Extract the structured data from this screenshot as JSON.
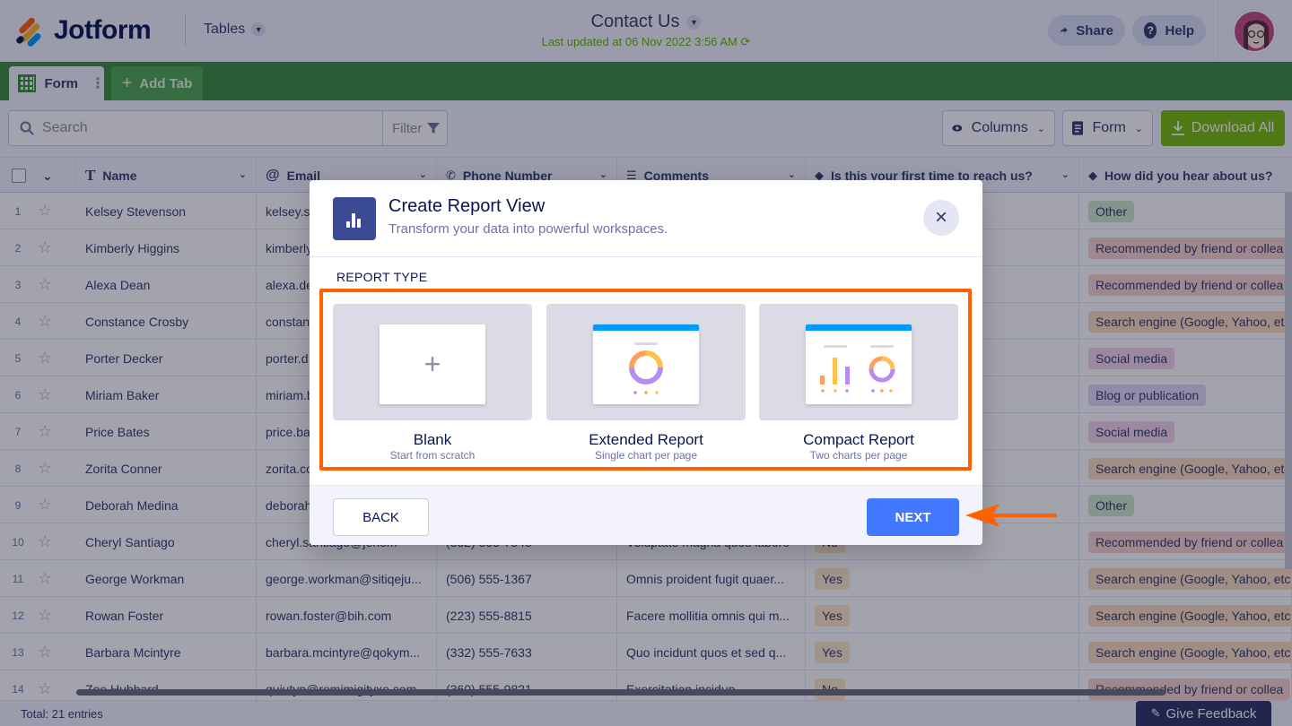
{
  "app": {
    "logo_text": "Jotform",
    "tables_label": "Tables"
  },
  "header": {
    "title": "Contact Us",
    "last_updated": "Last updated at 06 Nov 2022 3:56 AM",
    "share_label": "Share",
    "help_label": "Help"
  },
  "tabs": {
    "form_tab": "Form",
    "add_tab": "Add Tab"
  },
  "toolbar": {
    "search_placeholder": "Search",
    "filter_label": "Filter",
    "columns_label": "Columns",
    "form_label": "Form",
    "download_label": "Download All"
  },
  "table": {
    "columns": [
      "Name",
      "Email",
      "Phone Number",
      "Comments",
      "Is this your first time to reach us?",
      "How did you hear about us?"
    ],
    "rows": [
      {
        "num": "1",
        "name": "Kelsey Stevenson",
        "email": "kelsey.s",
        "phone": "",
        "comment": "",
        "first": "",
        "source": "Other",
        "src_color": "#cfe8cf"
      },
      {
        "num": "2",
        "name": "Kimberly Higgins",
        "email": "kimberly",
        "phone": "",
        "comment": "",
        "first": "",
        "source": "Recommended by friend or collea",
        "src_color": "#f8d3cd"
      },
      {
        "num": "3",
        "name": "Alexa Dean",
        "email": "alexa.de",
        "phone": "",
        "comment": "",
        "first": "",
        "source": "Recommended by friend or collea",
        "src_color": "#f8d3cd"
      },
      {
        "num": "4",
        "name": "Constance Crosby",
        "email": "constan",
        "phone": "",
        "comment": "",
        "first": "",
        "source": "Search engine (Google, Yahoo, etc",
        "src_color": "#fcdcc0"
      },
      {
        "num": "5",
        "name": "Porter Decker",
        "email": "porter.d",
        "phone": "",
        "comment": "",
        "first": "",
        "source": "Social media",
        "src_color": "#f5d3ea"
      },
      {
        "num": "6",
        "name": "Miriam Baker",
        "email": "miriam.b",
        "phone": "",
        "comment": "",
        "first": "",
        "source": "Blog or publication",
        "src_color": "#e2d8f5"
      },
      {
        "num": "7",
        "name": "Price Bates",
        "email": "price.ba",
        "phone": "",
        "comment": "",
        "first": "",
        "source": "Social media",
        "src_color": "#f5d3ea"
      },
      {
        "num": "8",
        "name": "Zorita Conner",
        "email": "zorita.co",
        "phone": "",
        "comment": "",
        "first": "",
        "source": "Search engine (Google, Yahoo, etc",
        "src_color": "#fcdcc0"
      },
      {
        "num": "9",
        "name": "Deborah Medina",
        "email": "deborah",
        "phone": "",
        "comment": "",
        "first": "",
        "source": "Other",
        "src_color": "#cfe8cf"
      },
      {
        "num": "10",
        "name": "Cheryl Santiago",
        "email": "cheryl.santiago@jenom",
        "phone": "(332) 555-7548",
        "comment": "Voluptate magna quos labore",
        "first": "No",
        "source": "Recommended by friend or collea",
        "src_color": "#f8d3cd"
      },
      {
        "num": "11",
        "name": "George Workman",
        "email": "george.workman@sitiqeju...",
        "phone": "(506) 555-1367",
        "comment": "Omnis proident fugit quaer...",
        "first": "Yes",
        "source": "Search engine (Google, Yahoo, etc",
        "src_color": "#fcdcc0"
      },
      {
        "num": "12",
        "name": "Rowan Foster",
        "email": "rowan.foster@bih.com",
        "phone": "(223) 555-8815",
        "comment": "Facere mollitia omnis qui m...",
        "first": "Yes",
        "source": "Search engine (Google, Yahoo, etc",
        "src_color": "#fcdcc0"
      },
      {
        "num": "13",
        "name": "Barbara Mcintyre",
        "email": "barbara.mcintyre@qokym...",
        "phone": "(332) 555-7633",
        "comment": "Quo incidunt quos et sed q...",
        "first": "Yes",
        "source": "Search engine (Google, Yahoo, etc",
        "src_color": "#fcdcc0"
      },
      {
        "num": "14",
        "name": "Zoe Hubbard",
        "email": "quiutyn@remimigityxe.com",
        "phone": "(360) 555-9821",
        "comment": "Exercitation incidun",
        "first": "No",
        "source": "Recommended by friend or collea",
        "src_color": "#f8d3cd"
      }
    ]
  },
  "footer": {
    "total": "Total: 21 entries",
    "feedback": "Give Feedback"
  },
  "modal": {
    "title": "Create Report View",
    "subtitle": "Transform your data into powerful workspaces.",
    "section_label": "REPORT TYPE",
    "options": [
      {
        "name": "Blank",
        "desc": "Start from scratch"
      },
      {
        "name": "Extended Report",
        "desc": "Single chart per page"
      },
      {
        "name": "Compact Report",
        "desc": "Two charts per page"
      }
    ],
    "back_label": "BACK",
    "next_label": "NEXT"
  },
  "colors": {
    "accent": "#ff6100",
    "primary": "#4277ff",
    "tab_green": "#3b8c3e",
    "download_green": "#78bb07"
  }
}
